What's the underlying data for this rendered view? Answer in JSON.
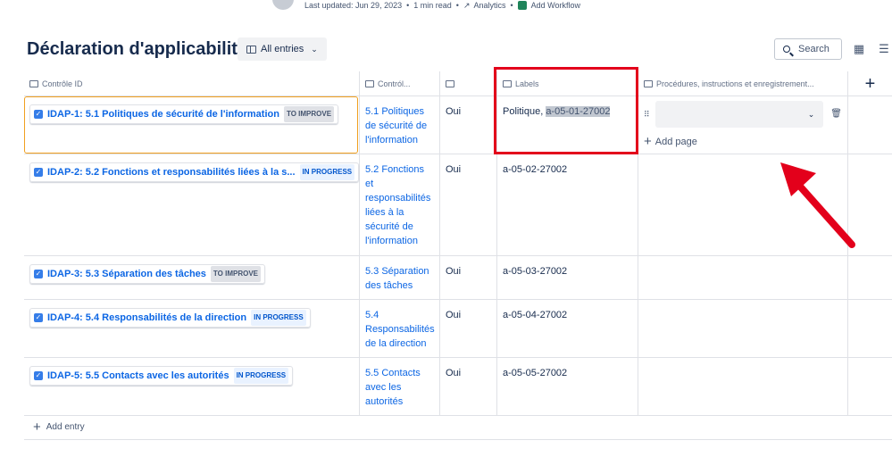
{
  "meta": {
    "last_updated": "Last updated: Jun 29, 2023",
    "read_time": "1 min read",
    "analytics": "Analytics",
    "add_workflow": "Add Workflow",
    "separator": "•"
  },
  "page": {
    "title": "Déclaration d'applicabilité",
    "view_label": "All entries",
    "search_label": "Search"
  },
  "columns": [
    {
      "label": "Contrôle ID"
    },
    {
      "label": "Contról..."
    },
    {
      "label": ""
    },
    {
      "label": "Labels"
    },
    {
      "label": "Procédures, instructions et enregistrement..."
    },
    {
      "label": "+"
    }
  ],
  "rows": [
    {
      "key": "IDAP-1: 5.1 Politiques de sécurité de l'information",
      "status": "TO IMPROVE",
      "control": "5.1 Politiques de sécurité de l'information",
      "applicable": "Oui",
      "label_prefix": "Politique, ",
      "label_highlight": "a-05-01-27002"
    },
    {
      "key": "IDAP-2: 5.2 Fonctions et responsabilités liées à la s...",
      "status": "IN PROGRESS",
      "control": "5.2 Fonctions et responsabilités liées à la sécurité de l'information",
      "applicable": "Oui",
      "label": "a-05-02-27002"
    },
    {
      "key": "IDAP-3: 5.3 Séparation des tâches",
      "status": "TO IMPROVE",
      "control": "5.3 Séparation des tâches",
      "applicable": "Oui",
      "label": "a-05-03-27002"
    },
    {
      "key": "IDAP-4: 5.4 Responsabilités de la direction",
      "status": "IN PROGRESS",
      "control": "5.4 Responsabilités de la direction",
      "applicable": "Oui",
      "label": "a-05-04-27002"
    },
    {
      "key": "IDAP-5: 5.5 Contacts avec les autorités",
      "status": "IN PROGRESS",
      "control": "5.5 Contacts avec les autorités",
      "applicable": "Oui",
      "label": "a-05-05-27002"
    }
  ],
  "actions": {
    "add_page": "Add page",
    "add_entry": "Add entry"
  },
  "colors": {
    "annotation": "#e3001b",
    "link": "#0c66e4",
    "selection": "#f0a020"
  }
}
